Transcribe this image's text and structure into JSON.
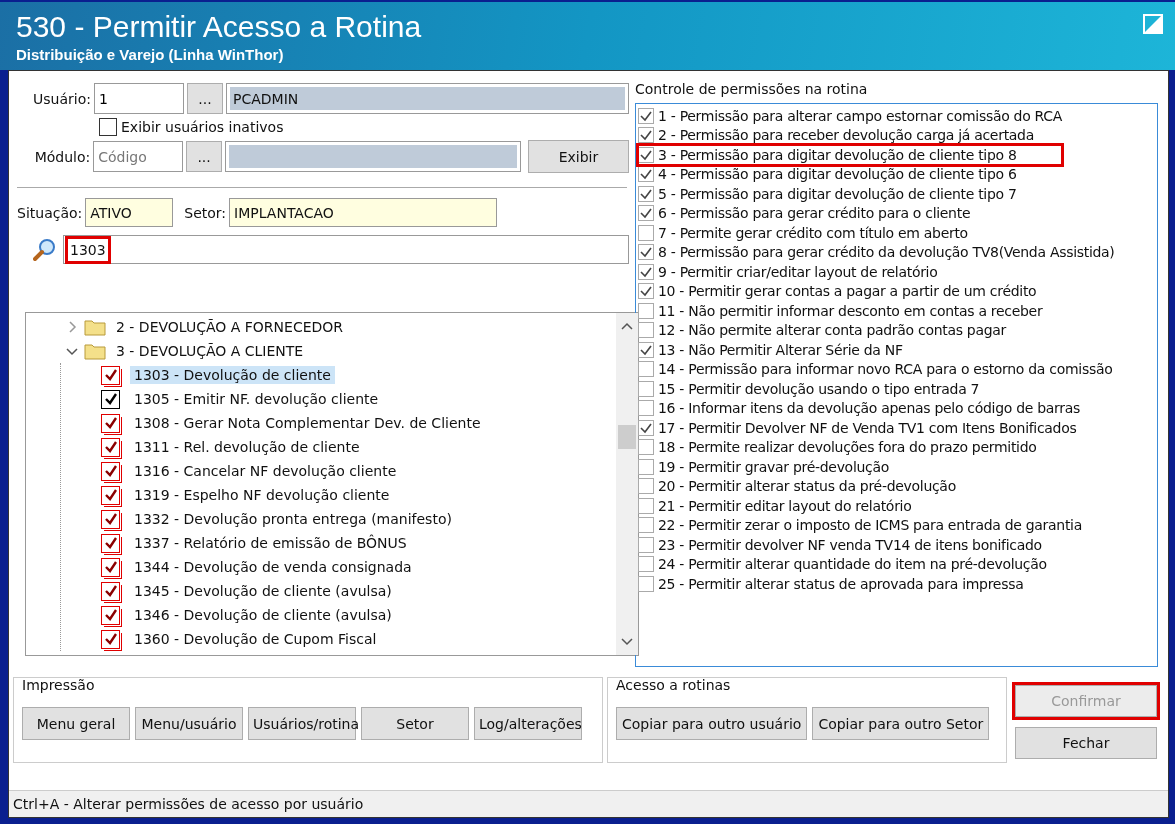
{
  "window": {
    "title": "530 - Permitir Acesso a Rotina",
    "subtitle": "Distribuição e Varejo (Linha WinThor)"
  },
  "user": {
    "label": "Usuário:",
    "code": "1",
    "lookup": "...",
    "name": "PCADMIN"
  },
  "show_inactive": {
    "label": "Exibir usuários inativos",
    "checked": false
  },
  "module": {
    "label": "Módulo:",
    "placeholder": "Código",
    "lookup": "...",
    "show_button": "Exibir"
  },
  "status": {
    "label": "Situação:",
    "value": "ATIVO"
  },
  "sector": {
    "label": "Setor:",
    "value": "IMPLANTACAO"
  },
  "search": {
    "value": "1303",
    "highlighted": true
  },
  "tree": [
    {
      "label": "2 - DEVOLUÇÃO A FORNECEDOR",
      "expanded": false
    },
    {
      "label": "3 - DEVOLUÇÃO A CLIENTE",
      "expanded": true,
      "children": [
        {
          "label": "1303 - Devolução de cliente",
          "checked": true,
          "flagged": true,
          "selected": true
        },
        {
          "label": "1305 - Emitir NF. devolução cliente",
          "checked": true,
          "flagged": false,
          "selected": false
        },
        {
          "label": "1308 - Gerar Nota Complementar Dev. de Cliente",
          "checked": true,
          "flagged": true,
          "selected": false
        },
        {
          "label": "1311 - Rel. devolução de cliente",
          "checked": true,
          "flagged": true,
          "selected": false
        },
        {
          "label": "1316 - Cancelar NF devolução cliente",
          "checked": true,
          "flagged": true,
          "selected": false
        },
        {
          "label": "1319 - Espelho NF devolução cliente",
          "checked": true,
          "flagged": true,
          "selected": false
        },
        {
          "label": "1332 - Devolução pronta entrega (manifesto)",
          "checked": true,
          "flagged": true,
          "selected": false
        },
        {
          "label": "1337 - Relatório de emissão de BÔNUS",
          "checked": true,
          "flagged": true,
          "selected": false
        },
        {
          "label": "1344 - Devolução de venda consignada",
          "checked": true,
          "flagged": true,
          "selected": false
        },
        {
          "label": "1345 - Devolução de cliente (avulsa)",
          "checked": true,
          "flagged": true,
          "selected": false
        },
        {
          "label": "1346 - Devolução de cliente (avulsa)",
          "checked": true,
          "flagged": true,
          "selected": false
        },
        {
          "label": "1360 - Devolução de Cupom Fiscal",
          "checked": true,
          "flagged": true,
          "selected": false
        }
      ]
    }
  ],
  "permissions": {
    "title": "Controle de permissões na rotina",
    "items": [
      {
        "label": "1 - Permissão para alterar campo estornar comissão do RCA",
        "checked": true,
        "highlighted": false
      },
      {
        "label": "2 - Permissão para receber devolução carga já acertada",
        "checked": true,
        "highlighted": false
      },
      {
        "label": "3 - Permissão para digitar devolução de cliente tipo 8",
        "checked": true,
        "highlighted": true
      },
      {
        "label": "4 - Permissão para digitar devolução de cliente tipo 6",
        "checked": true,
        "highlighted": false
      },
      {
        "label": "5 - Permissão para digitar devolução de cliente tipo 7",
        "checked": true,
        "highlighted": false
      },
      {
        "label": "6 - Permissão para gerar crédito para o cliente",
        "checked": true,
        "highlighted": false
      },
      {
        "label": "7 - Permite gerar crédito com título em aberto",
        "checked": false,
        "highlighted": false
      },
      {
        "label": "8 - Permissão para gerar crédito da devolução TV8(Venda Assistida)",
        "checked": true,
        "highlighted": false
      },
      {
        "label": "9 - Permitir criar/editar layout de relatório",
        "checked": true,
        "highlighted": false
      },
      {
        "label": "10 - Permitir gerar contas a pagar a partir de um crédito",
        "checked": true,
        "highlighted": false
      },
      {
        "label": "11 - Não permitir informar desconto em contas a receber",
        "checked": false,
        "highlighted": false
      },
      {
        "label": "12 - Não permite alterar conta padrão contas pagar",
        "checked": false,
        "highlighted": false
      },
      {
        "label": "13 - Não Permitir Alterar Série da NF",
        "checked": true,
        "highlighted": false
      },
      {
        "label": "14 - Permissão para informar novo RCA para o estorno da comissão",
        "checked": false,
        "highlighted": false
      },
      {
        "label": "15 - Permitir devolução usando o tipo entrada 7",
        "checked": false,
        "highlighted": false
      },
      {
        "label": "16 - Informar itens da devolução apenas pelo código de barras",
        "checked": false,
        "highlighted": false
      },
      {
        "label": "17 - Permitir Devolver NF de Venda TV1 com Itens Bonificados",
        "checked": true,
        "highlighted": false
      },
      {
        "label": "18 - Permite realizar devoluções fora do prazo permitido",
        "checked": false,
        "highlighted": false
      },
      {
        "label": "19 - Permitir gravar pré-devolução",
        "checked": false,
        "highlighted": false
      },
      {
        "label": "20 - Permitir alterar status da pré-devolução",
        "checked": false,
        "highlighted": false
      },
      {
        "label": "21 - Permitir editar layout do relatório",
        "checked": false,
        "highlighted": false
      },
      {
        "label": "22 - Permitir zerar o imposto de ICMS para entrada de garantia",
        "checked": false,
        "highlighted": false
      },
      {
        "label": "23 - Permitir devolver NF venda TV14 de itens bonificado",
        "checked": false,
        "highlighted": false
      },
      {
        "label": "24 - Permitir alterar quantidade do item na pré-devolução",
        "checked": false,
        "highlighted": false
      },
      {
        "label": "25 - Permitir alterar status de aprovada para impressa",
        "checked": false,
        "highlighted": false
      }
    ]
  },
  "printing": {
    "title": "Impressão",
    "buttons": [
      "Menu geral",
      "Menu/usuário",
      "Usuários/rotina",
      "Setor",
      "Log/alterações"
    ]
  },
  "routine_access": {
    "title": "Acesso a rotinas",
    "buttons": [
      "Copiar para outro usuário",
      "Copiar para outro Setor"
    ]
  },
  "actions": [
    {
      "label": "Confirmar",
      "disabled": true,
      "highlighted": true
    },
    {
      "label": "Fechar",
      "disabled": false,
      "highlighted": false
    }
  ],
  "status_bar": "Ctrl+A - Alterar permissões de acesso por usuário"
}
